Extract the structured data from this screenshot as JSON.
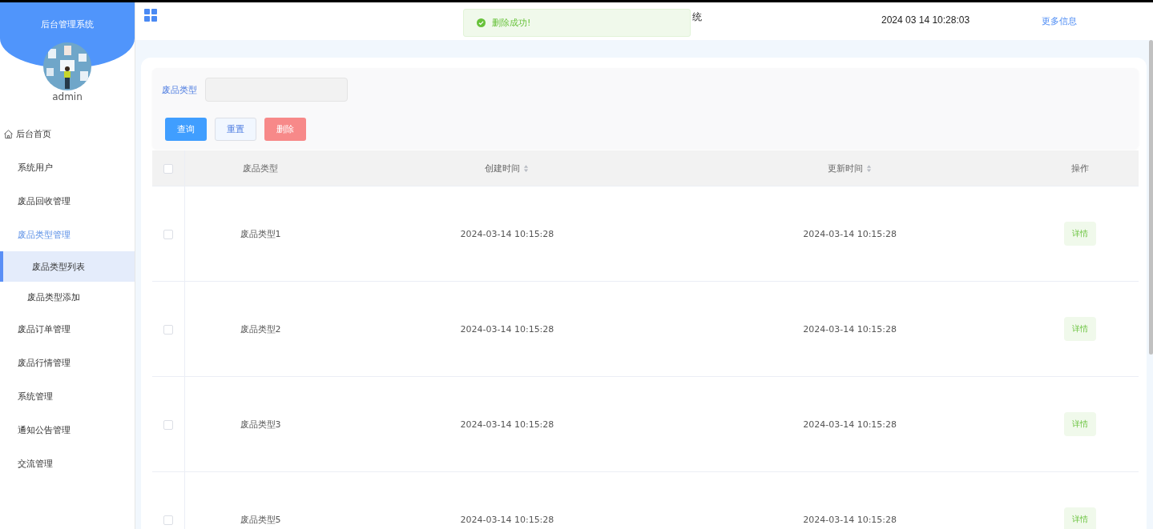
{
  "sidebar": {
    "title": "后台管理系统",
    "user": "admin",
    "items": [
      {
        "label": "后台首页",
        "kind": "home",
        "selected": false
      },
      {
        "label": "系统用户",
        "kind": "menu",
        "selected": false
      },
      {
        "label": "废品回收管理",
        "kind": "menu",
        "selected": false
      },
      {
        "label": "废品类型管理",
        "kind": "menu",
        "selected": false,
        "expanded": true,
        "children": [
          {
            "label": "废品类型列表",
            "selected": true
          },
          {
            "label": "废品类型添加",
            "selected": false
          }
        ]
      },
      {
        "label": "废品订单管理",
        "kind": "menu",
        "selected": false
      },
      {
        "label": "废品行情管理",
        "kind": "menu",
        "selected": false
      },
      {
        "label": "系统管理",
        "kind": "menu",
        "selected": false
      },
      {
        "label": "通知公告管理",
        "kind": "menu",
        "selected": false
      },
      {
        "label": "交流管理",
        "kind": "menu",
        "selected": false
      }
    ]
  },
  "header": {
    "title": "统",
    "datetime": "2024 03 14 10:28:03",
    "more_link": "更多信息"
  },
  "toast": {
    "message": "删除成功!"
  },
  "search": {
    "label": "废品类型"
  },
  "buttons": [
    {
      "label": "查询",
      "kind": "primary"
    },
    {
      "label": "重置",
      "kind": "plain"
    },
    {
      "label": "删除",
      "kind": "danger"
    }
  ],
  "table": {
    "select_all": {
      "checked": false
    },
    "columns": [
      {
        "label": "废品类型",
        "sortable": false
      },
      {
        "label": "创建时间",
        "sortable": true
      },
      {
        "label": "更新时间",
        "sortable": true
      },
      {
        "label": "操作",
        "sortable": false
      }
    ],
    "rows": [
      {
        "checked": false,
        "type": "废品类型1",
        "created": "2024-03-14 10:15:28",
        "updated": "2024-03-14 10:15:28",
        "action": "详情"
      },
      {
        "checked": false,
        "type": "废品类型2",
        "created": "2024-03-14 10:15:28",
        "updated": "2024-03-14 10:15:28",
        "action": "详情"
      },
      {
        "checked": false,
        "type": "废品类型3",
        "created": "2024-03-14 10:15:28",
        "updated": "2024-03-14 10:15:28",
        "action": "详情"
      },
      {
        "checked": false,
        "type": "废品类型5",
        "created": "2024-03-14 10:15:28",
        "updated": "2024-03-14 10:15:28",
        "action": "详情"
      }
    ]
  }
}
